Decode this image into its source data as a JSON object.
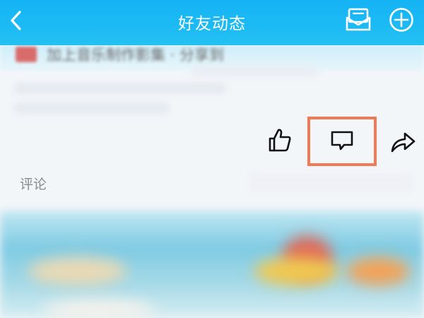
{
  "header": {
    "title": "好友动态",
    "back_icon": "chevron-left-icon",
    "mail_icon": "envelope-icon",
    "add_icon": "plus-circle-icon",
    "background": "#1ab8f3"
  },
  "post": {
    "snippet": "加上音乐制作影集 · 分享到"
  },
  "actions": {
    "like_icon": "thumbs-up-icon",
    "comment_icon": "comment-bubble-icon",
    "share_icon": "share-arrow-icon",
    "highlight_color": "#ef7a55"
  },
  "comments": {
    "label": "评论"
  }
}
